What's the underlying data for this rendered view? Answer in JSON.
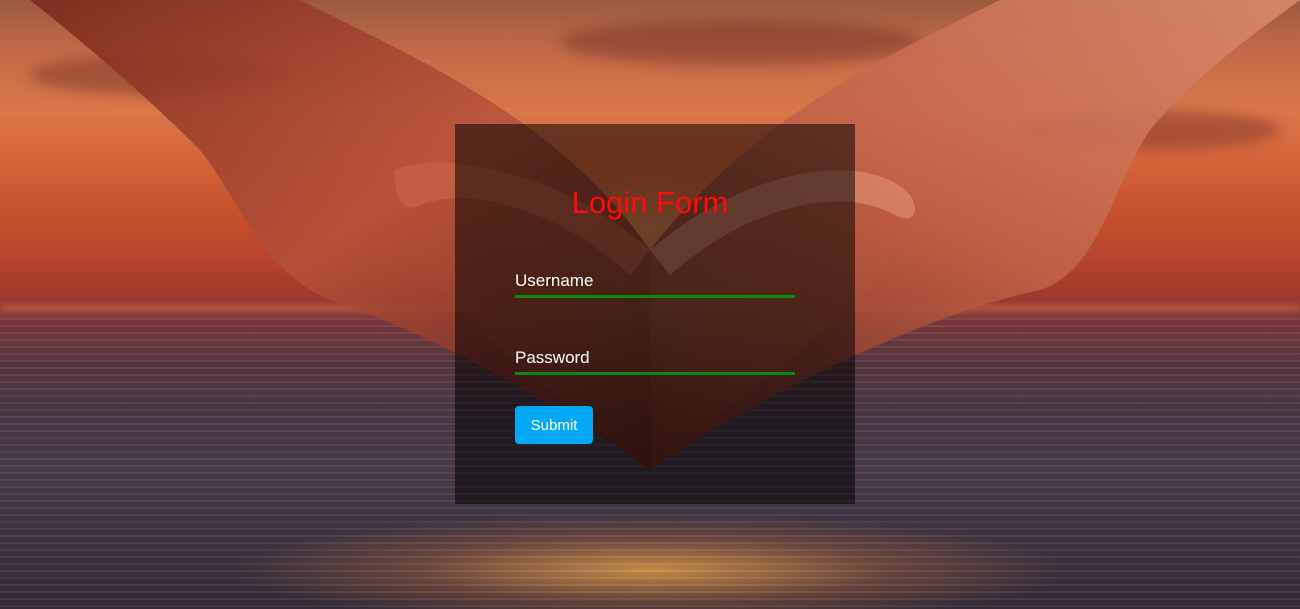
{
  "login": {
    "title": "Login Form",
    "username_placeholder": "Username",
    "password_placeholder": "Password",
    "submit_label": "Submit"
  },
  "colors": {
    "title": "#ff0b0b",
    "field_underline": "#0a8a0a",
    "submit_button": "#03a9f4",
    "panel_overlay": "rgba(0,0,0,0.52)"
  }
}
